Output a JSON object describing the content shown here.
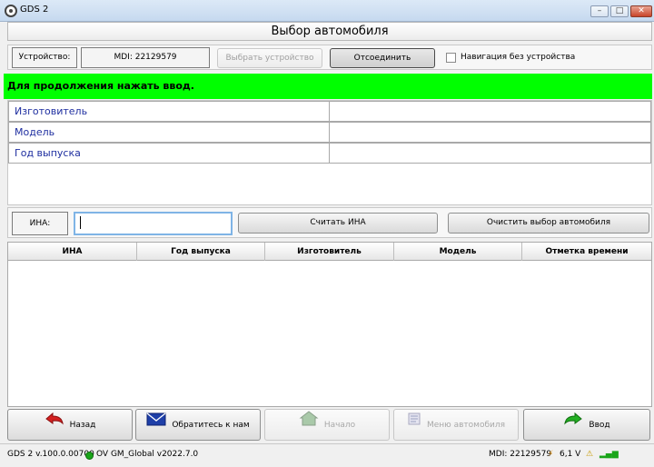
{
  "window": {
    "title": "GDS 2"
  },
  "header": {
    "title": "Выбор автомобиля"
  },
  "device": {
    "label": "Устройство:",
    "value": "MDI: 22129579",
    "select_button": "Выбрать устройство",
    "disconnect_button": "Отсоединить",
    "nav_checkbox_label": "Навигация без устройства",
    "nav_checkbox_checked": false
  },
  "status": {
    "message": "Для продолжения нажать ввод.",
    "color": "#00ff00"
  },
  "vehicle": {
    "rows": [
      {
        "label": "Изготовитель",
        "value": ""
      },
      {
        "label": "Модель",
        "value": ""
      },
      {
        "label": "Год выпуска",
        "value": ""
      }
    ]
  },
  "vin": {
    "label": "ИНА:",
    "value": "",
    "read_button": "Считать ИНА",
    "clear_button": "Очистить выбор автомобиля"
  },
  "history": {
    "columns": [
      "ИНА",
      "Год выпуска",
      "Изготовитель",
      "Модель",
      "Отметка времени"
    ],
    "rows": []
  },
  "toolbar": {
    "back": "Назад",
    "contact": "Обратитесь к нам",
    "home": "Начало",
    "menu": "Меню автомобиля",
    "enter": "Ввод"
  },
  "footer": {
    "version": "GDS 2 v.100.0.00700",
    "database": "OV GM_Global v2022.7.0",
    "device": "MDI: 22129579",
    "voltage": "6,1 V"
  }
}
